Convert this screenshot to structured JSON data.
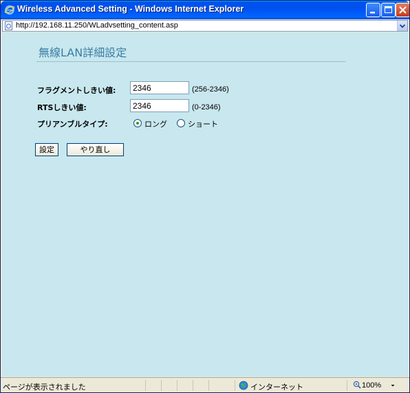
{
  "window": {
    "title": "Wireless Advanced Setting - Windows Internet Explorer"
  },
  "address_bar": {
    "url": "http://192.168.11.250/WLadvsetting_content.asp"
  },
  "page": {
    "heading": "無線LAN詳細設定",
    "fields": [
      {
        "label": "フラグメントしきい値:",
        "value": "2346",
        "range": "(256-2346)"
      },
      {
        "label": "RTSしきい値:",
        "value": "2346",
        "range": "(0-2346)"
      }
    ],
    "preamble": {
      "label": "プリアンブルタイプ:",
      "options": [
        {
          "label": "ロング",
          "selected": true
        },
        {
          "label": "ショート",
          "selected": false
        }
      ]
    },
    "buttons": {
      "apply": "設定",
      "reset": "やり直し"
    }
  },
  "status_bar": {
    "text": "ページが表示されました",
    "zone": "インターネット",
    "zoom": "100%"
  },
  "colors": {
    "content_bg": "#c8e7ee",
    "heading": "#3a7ea3",
    "titlebar": "#0055e5"
  },
  "icons": [
    "ie-logo-icon",
    "minimize-icon",
    "maximize-icon",
    "close-icon",
    "page-icon",
    "globe-icon",
    "zoom-icon",
    "chevron-down-icon"
  ]
}
